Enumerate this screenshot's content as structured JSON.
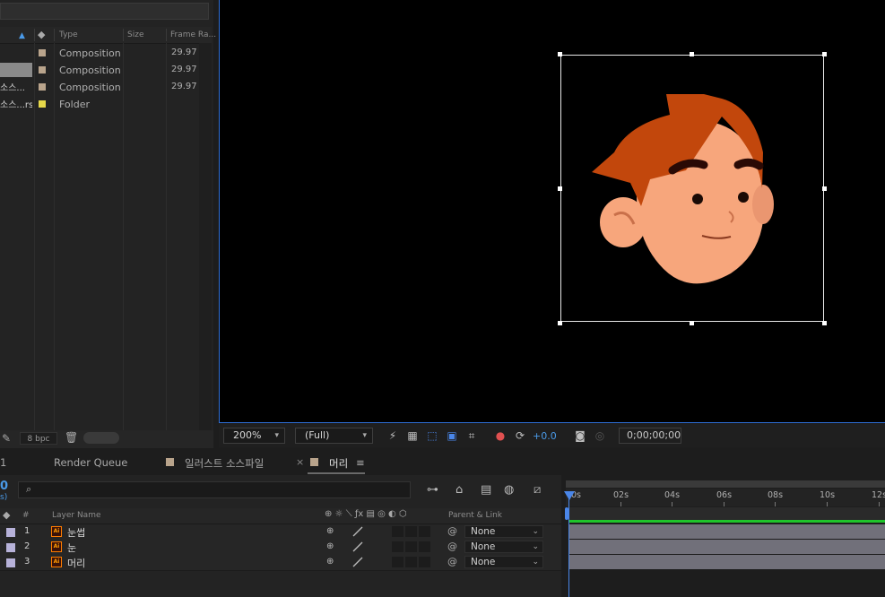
{
  "project": {
    "columns": {
      "type": "Type",
      "size": "Size",
      "frame_rate": "Frame Ra..."
    },
    "items": [
      {
        "name": "",
        "type": "Composition",
        "frame_rate": "29.97",
        "swatch": "#b9a48c",
        "selected": false
      },
      {
        "name": "",
        "type": "Composition",
        "frame_rate": "29.97",
        "swatch": "#b9a48c",
        "selected": true
      },
      {
        "name": "소스...",
        "type": "Composition",
        "frame_rate": "29.97",
        "swatch": "#b9a48c",
        "selected": false
      },
      {
        "name": "소스...rs",
        "type": "Folder",
        "frame_rate": "",
        "swatch": "#e6d84a",
        "selected": false
      }
    ],
    "bpc": "8 bpc"
  },
  "viewer": {
    "zoom": "200%",
    "resolution": "(Full)",
    "exposure": "+0.0",
    "timecode": "0;00;00;00"
  },
  "tabs": {
    "left_fragment": "1",
    "render_queue": "Render Queue",
    "comp1": "일러스트 소스파일",
    "comp2": "머리"
  },
  "timeline": {
    "current_time_fragment": "0",
    "fps_fragment": "s)",
    "headers": {
      "num": "#",
      "layer_name": "Layer Name",
      "parent_link": "Parent & Link"
    },
    "layers": [
      {
        "num": "1",
        "name": "눈썹",
        "parent": "None"
      },
      {
        "num": "2",
        "name": "눈",
        "parent": "None"
      },
      {
        "num": "3",
        "name": "머리",
        "parent": "None"
      }
    ],
    "ruler": [
      "0s",
      "02s",
      "04s",
      "06s",
      "08s",
      "10s",
      "12s"
    ]
  },
  "colors": {
    "accent": "#4a86e8",
    "layer_label": "#b7b2d9",
    "composition_label": "#b9a48c",
    "folder_label": "#e6d84a",
    "hair": "#c2470c",
    "skin": "#f7a67c"
  }
}
